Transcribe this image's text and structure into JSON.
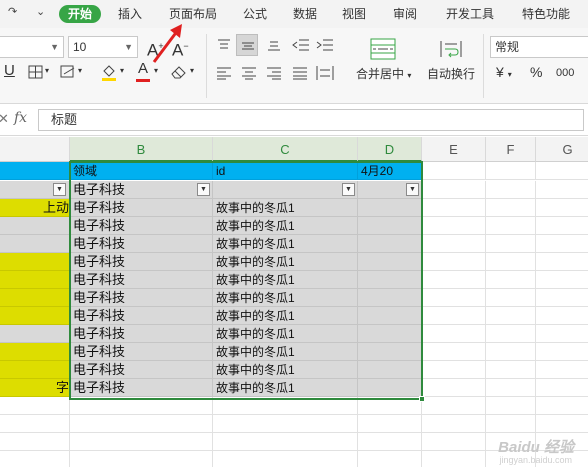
{
  "ribbon_tabs": {
    "home": "开始",
    "insert": "插入",
    "page_layout": "页面布局",
    "formula": "公式",
    "data": "数据",
    "view": "视图",
    "review": "审阅",
    "developer": "开发工具",
    "special": "特色功能"
  },
  "ribbon": {
    "font_size": "10",
    "merge_label": "合并居中",
    "wrap_label": "自动换行",
    "number_format": "常规",
    "currency_symbol": "¥",
    "percent_symbol": "%",
    "thousands_symbol": "000",
    "grow_font": "A",
    "shrink_font": "A",
    "font_color_letter": "A",
    "underline_letter": "U"
  },
  "formula_bar": {
    "cancel_symbol": "✕",
    "fx_label": "fx",
    "value": "标题"
  },
  "columns": [
    "B",
    "C",
    "D",
    "E",
    "F",
    "G"
  ],
  "header_row": {
    "b": "领域",
    "c": "id",
    "d": "4月20"
  },
  "filter_row": {
    "b": "电子科技"
  },
  "rows": [
    {
      "a": "上动",
      "b": "电子科技",
      "c": "故事中的冬瓜1"
    },
    {
      "a": "",
      "b": "电子科技",
      "c": "故事中的冬瓜1"
    },
    {
      "a": "",
      "b": "电子科技",
      "c": "故事中的冬瓜1"
    },
    {
      "a": "",
      "b": "电子科技",
      "c": "故事中的冬瓜1"
    },
    {
      "a": "",
      "b": "电子科技",
      "c": "故事中的冬瓜1"
    },
    {
      "a": "",
      "b": "电子科技",
      "c": "故事中的冬瓜1"
    },
    {
      "a": "",
      "b": "电子科技",
      "c": "故事中的冬瓜1"
    },
    {
      "a": "",
      "b": "电子科技",
      "c": "故事中的冬瓜1"
    },
    {
      "a": "",
      "b": "电子科技",
      "c": "故事中的冬瓜1"
    },
    {
      "a": "",
      "b": "电子科技",
      "c": "故事中的冬瓜1"
    },
    {
      "a": "字",
      "b": "电子科技",
      "c": "故事中的冬瓜1"
    }
  ],
  "watermark": {
    "main": "Baidu 经验",
    "sub": "jingyan.baidu.com"
  },
  "colors": {
    "accent_green": "#37a546",
    "header_blue": "#00b0f0",
    "highlight_yellow": "#dddd00",
    "table_gray": "#d9d9d9",
    "arrow_red": "#e02020"
  }
}
